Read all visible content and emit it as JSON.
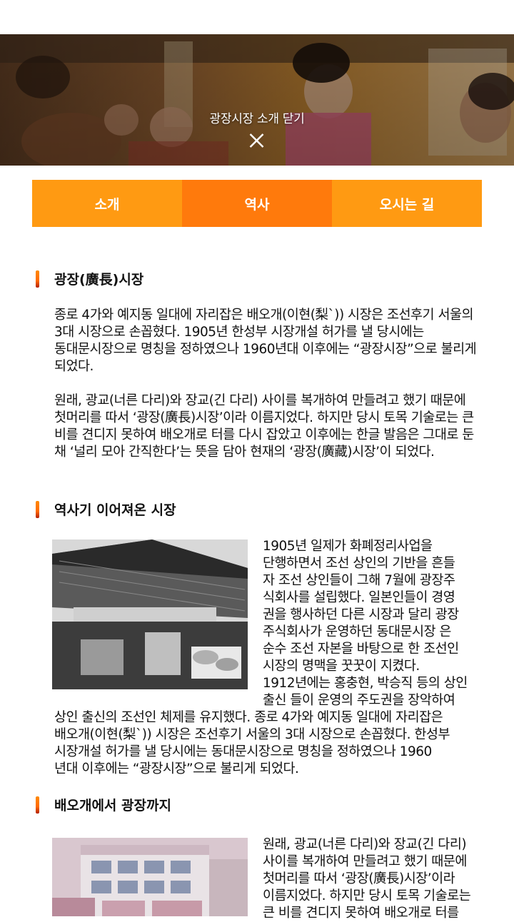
{
  "hero": {
    "close_label": "광장시장 소개 닫기"
  },
  "tabs": [
    {
      "label": "소개",
      "active": false
    },
    {
      "label": "역사",
      "active": true
    },
    {
      "label": "오시는 길",
      "active": false
    }
  ],
  "colors": {
    "tab_normal": "#ff9a12",
    "tab_active": "#ff7a0c",
    "accent_bar": "#ff7a00"
  },
  "sections": {
    "s1": {
      "title": "광장(廣長)시장",
      "p1": "종로 4가와 예지동 일대에 자리잡은 배오개(이현(梨`)) 시장은 조선후기 서울의 3대 시장으로 손꼽혔다. 1905년 한성부 시장개설 허가를 낼 당시에는 동대문시장으로 명칭을 정하였으나 1960년대 이후에는 “광장시장”으로 불리게 되었다.",
      "p2": "원래, 광교(너른 다리)와 장교(긴 다리) 사이를 복개하여 만들려고 했기 때문에 첫머리를 따서 ‘광장(廣長)시장’이라 이름지었다. 하지만 당시 토목 기술로는 큰 비를 견디지 못하여 배오개로 터를 다시 잡았고 이후에는 한글 발음은 그대로 둔 채 ‘널리 모아 간직한다’는 뜻을 담아 현재의 ‘광장(廣藏)시장’이 되었다."
    },
    "s2": {
      "title": "역사기 이어져온 시장",
      "float_lines": [
        "1905년 일제가 화폐정리사업을",
        "단행하면서 조선 상인의 기반을 흔들",
        "자 조선 상인들이 그해 7월에 광장주",
        "식회사를 설립했다. 일본인들이 경영",
        "권을 행사하던 다른 시장과 달리 광장",
        "주식회사가 운영하던 동대문시장 은",
        "순수 조선 자본을 바탕으로 한 조선인",
        "시장의 명맥을 꿋꿋이 지켰다.",
        "1912년에는 홍충현, 박승직 등의 상인",
        "출신 들이 운영의 주도권을 장악하여"
      ],
      "full_lines": [
        "상인 출신의 조선인 체제를 유지했다. 종로 4가와 예지동 일대에 자리잡은",
        "배오개(이현(梨`)) 시장은 조선후기 서울의 3대 시장으로 손꼽혔다. 한성부",
        "시장개설 허가를 낼 당시에는 동대문시장으로 명칭을 정하였으나 1960",
        "년대 이후에는 “광장시장”으로 불리게 되었다."
      ]
    },
    "s3": {
      "title": "배오개에서 광장까지",
      "float_lines": [
        "원래, 광교(너른 다리)와 장교(긴 다리)",
        "사이를 복개하여 만들려고 했기 때문에",
        "첫머리를 따서 ‘광장(廣長)시장’이라",
        "이름지었다. 하지만 당시 토목 기술로는",
        "큰 비를 견디지 못하여 배오개로 터를"
      ]
    }
  }
}
